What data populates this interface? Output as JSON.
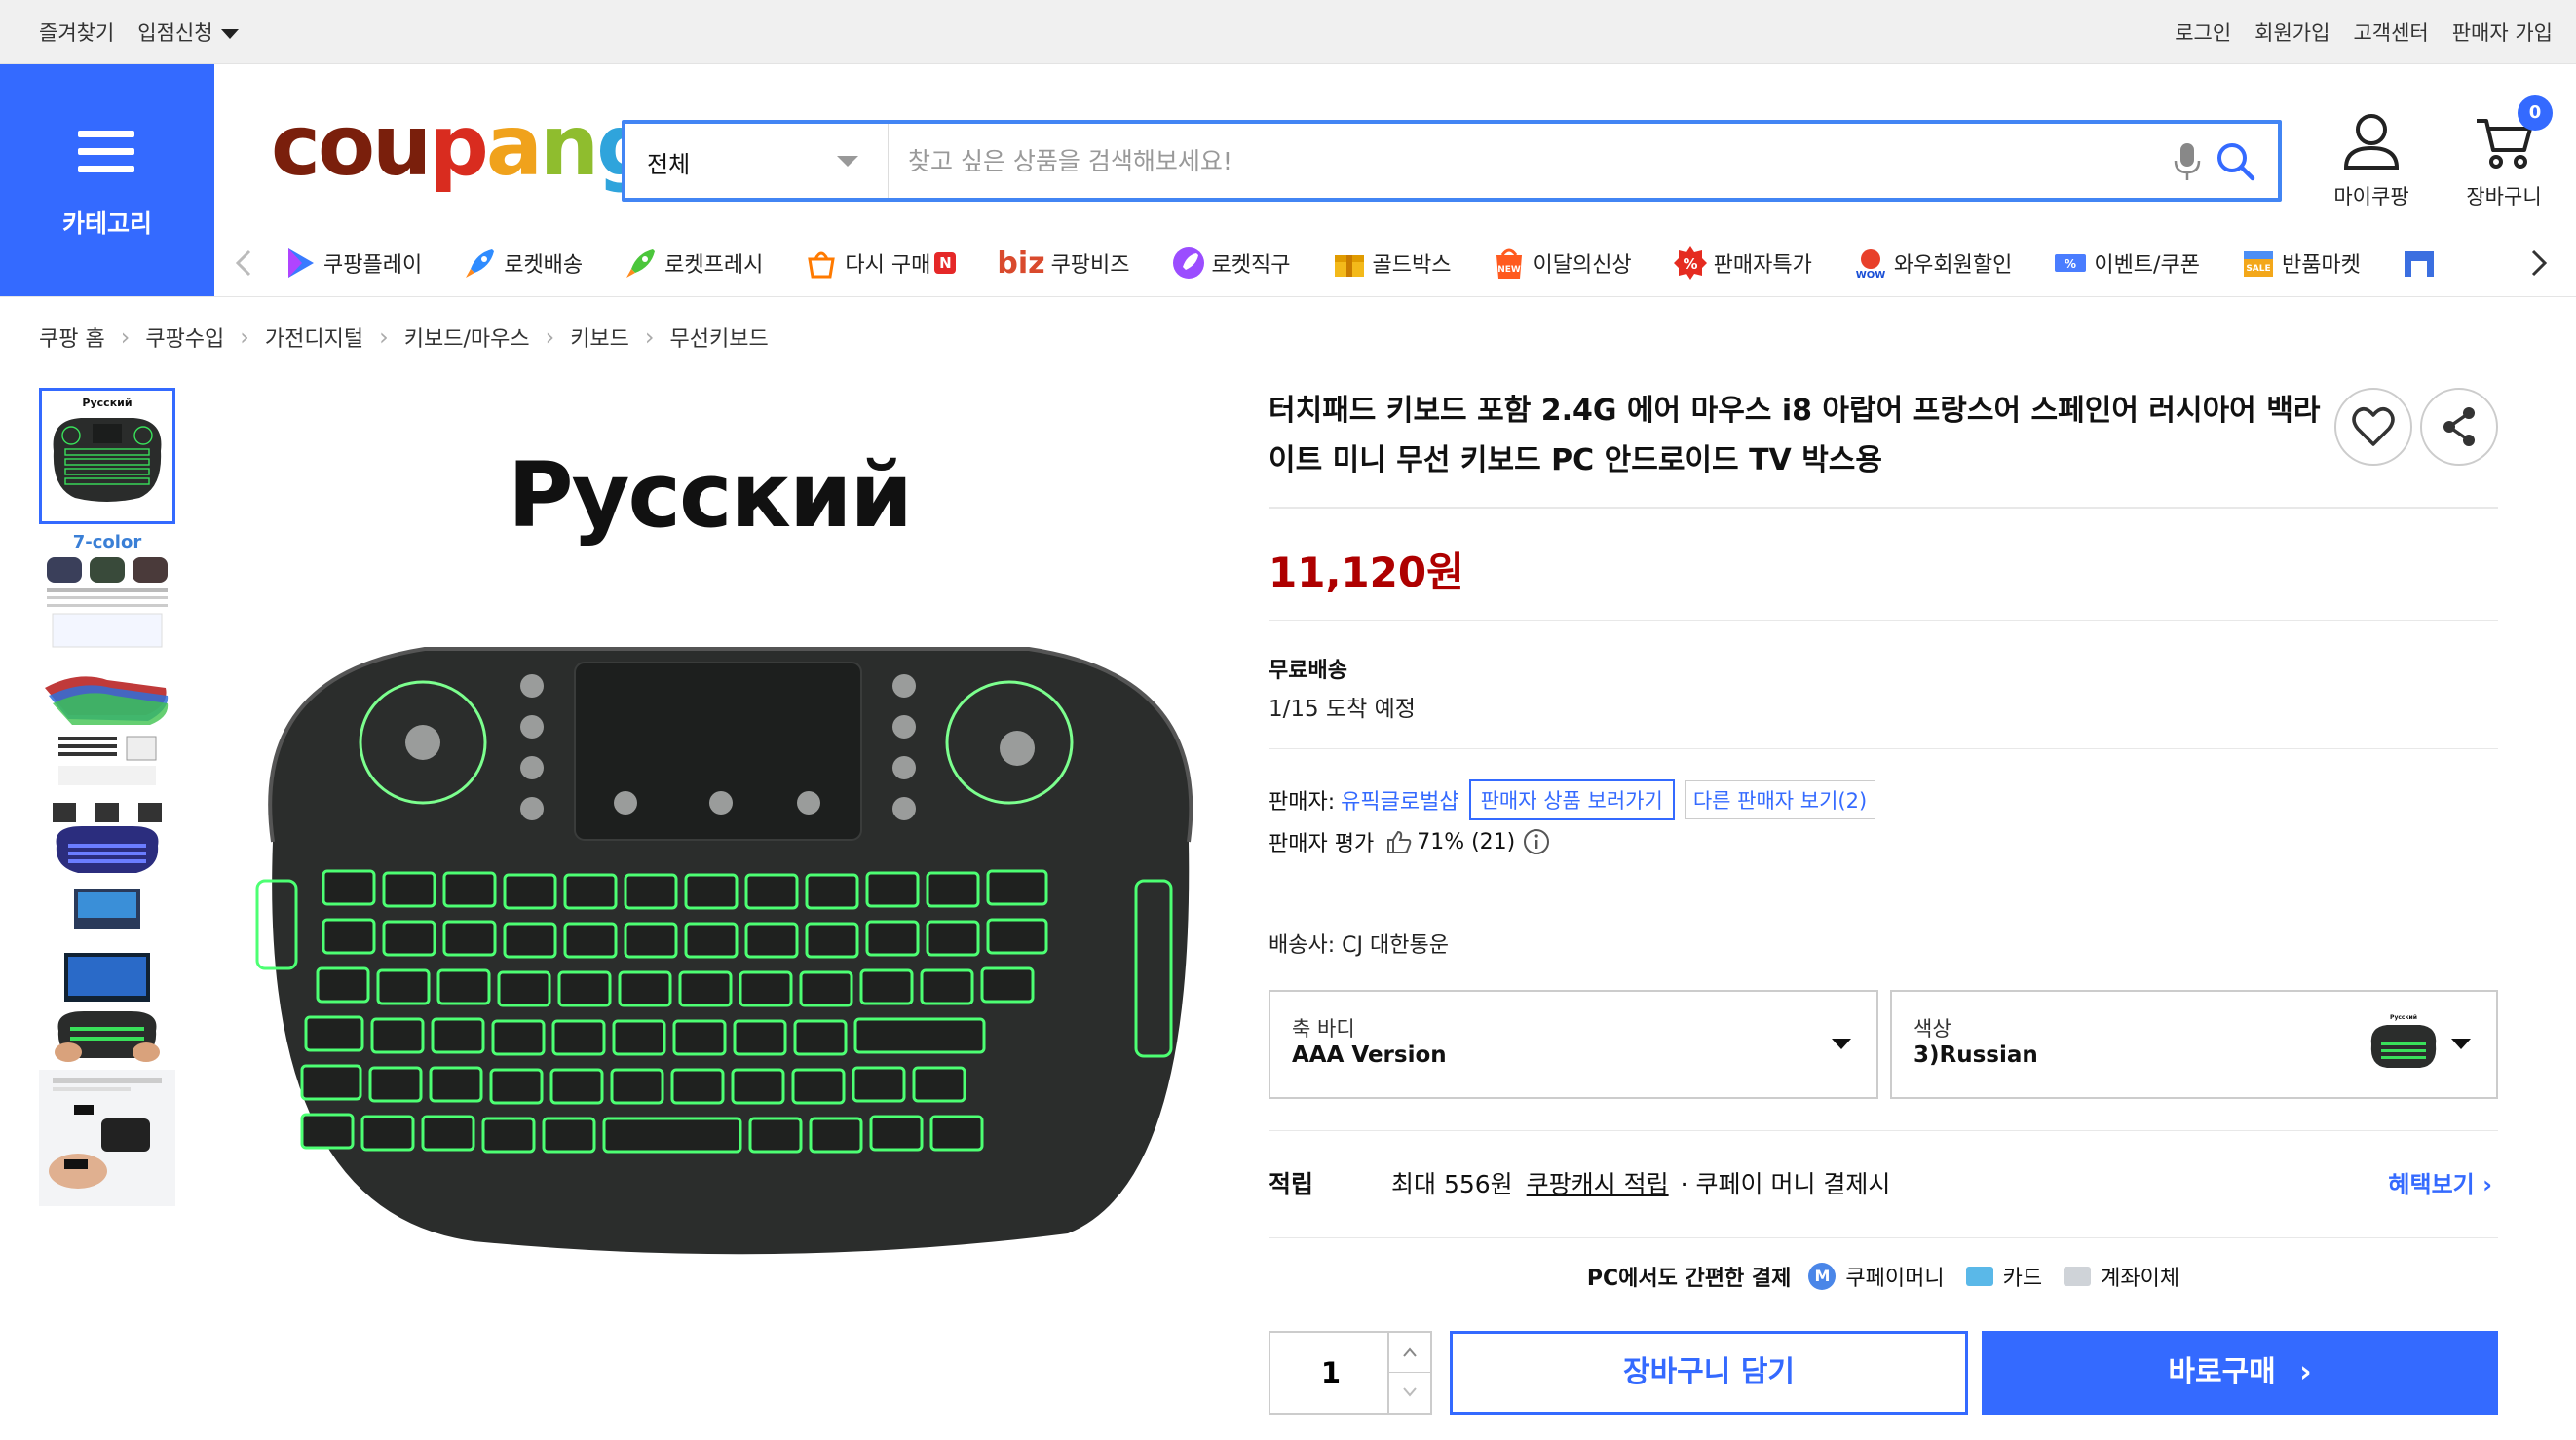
{
  "topbar": {
    "favorites": "즐겨찾기",
    "store_apply": "입점신청",
    "login": "로그인",
    "signup": "회원가입",
    "support": "고객센터",
    "seller_signup": "판매자 가입"
  },
  "header": {
    "category_label": "카테고리",
    "logo": {
      "c1": "cou",
      "c2": "p",
      "c3": "a",
      "c4": "n",
      "c5": "g"
    },
    "search_scope": "전체",
    "search_placeholder": "찾고 싶은 상품을 검색해보세요!",
    "my_coupang": "마이쿠팡",
    "cart": "장바구니",
    "cart_count": "0"
  },
  "nav": {
    "items": [
      {
        "label": "쿠팡플레이",
        "icon": "play-icon"
      },
      {
        "label": "로켓배송",
        "icon": "rocket-icon"
      },
      {
        "label": "로켓프레시",
        "icon": "rocket-fresh-icon"
      },
      {
        "label": "다시 구매",
        "icon": "repurchase-icon",
        "badge": "N"
      },
      {
        "label": "쿠팡비즈",
        "prefix": "biz",
        "icon": "biz-icon"
      },
      {
        "label": "로켓직구",
        "icon": "rocket-global-icon"
      },
      {
        "label": "골드박스",
        "icon": "goldbox-icon"
      },
      {
        "label": "이달의신상",
        "icon": "new-icon",
        "badge_text": "NEW"
      },
      {
        "label": "판매자특가",
        "icon": "seller-deal-icon",
        "badge_text": "%"
      },
      {
        "label": "와우회원할인",
        "icon": "wow-icon",
        "badge_text": "WOW"
      },
      {
        "label": "이벤트/쿠폰",
        "icon": "coupon-icon",
        "badge_text": "%"
      },
      {
        "label": "반품마켓",
        "icon": "return-market-icon",
        "badge_text": "SALE"
      }
    ]
  },
  "breadcrumb": [
    "쿠팡 홈",
    "쿠팡수입",
    "가전디지털",
    "키보드/마우스",
    "키보드",
    "무선키보드"
  ],
  "product": {
    "image_caption": "Русский",
    "title": "터치패드 키보드 포함 2.4G 에어 마우스 i8 아랍어 프랑스어 스페인어 러시아어 백라이트 미니 무선 키보드 PC 안드로이드 TV 박스용",
    "price": "11,120원",
    "shipping_label": "무료배송",
    "arrival": "1/15 도착 예정",
    "seller_label": "판매자:",
    "seller_name": "유픽글로벌샵",
    "seller_products": "판매자 상품 보러가기",
    "other_sellers": "다른 판매자 보기(2)",
    "rating_label": "판매자 평가",
    "rating_value": "71% (21)",
    "carrier": "배송사:  CJ 대한통운",
    "option1_label": "축 바디",
    "option1_value": "AAA Version",
    "option2_label": "색상",
    "option2_value": "3)Russian",
    "reward_label": "적립",
    "reward_max": "최대 556원",
    "reward_cash": "쿠팡캐시 적립",
    "reward_cond": "· 쿠페이 머니 결제시",
    "reward_more": "혜택보기",
    "pay_lead": "PC에서도 간편한 결제",
    "pay_money": "쿠페이머니",
    "pay_card": "카드",
    "pay_bank": "계좌이체",
    "quantity": "1",
    "add_to_cart": "장바구니 담기",
    "buy_now": "바로구매"
  },
  "thumbnail_texts": {
    "t1": "Русский",
    "t2": "7-color"
  },
  "colors": {
    "accent": "#346aff",
    "price": "#ae0000",
    "keyboard_glow": "#39ff6a"
  }
}
